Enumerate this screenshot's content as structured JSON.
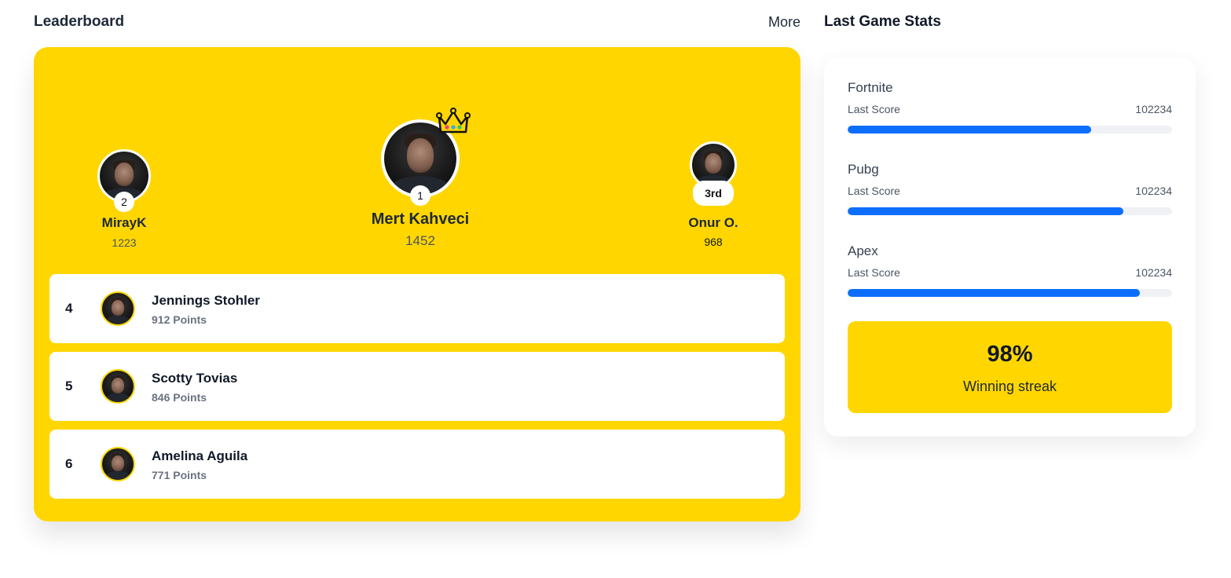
{
  "leaderboard": {
    "title": "Leaderboard",
    "more_label": "More",
    "podium": {
      "first": {
        "name": "Mert Kahveci",
        "score": "1452",
        "rank": "1",
        "icon": "crown-icon"
      },
      "second": {
        "name": "MirayK",
        "score": "1223",
        "rank": "2"
      },
      "third": {
        "name": "Onur O.",
        "score": "968",
        "rank": "3rd"
      }
    },
    "rows": [
      {
        "rank": "4",
        "name": "Jennings Stohler",
        "points": "912 Points"
      },
      {
        "rank": "5",
        "name": "Scotty Tovias",
        "points": "846 Points"
      },
      {
        "rank": "6",
        "name": "Amelina Aguila",
        "points": "771 Points"
      }
    ]
  },
  "stats": {
    "title": "Last Game Stats",
    "games": [
      {
        "name": "Fortnite",
        "label": "Last Score",
        "value": "102234",
        "progress": 0.75
      },
      {
        "name": "Pubg",
        "label": "Last Score",
        "value": "102234",
        "progress": 0.85
      },
      {
        "name": "Apex",
        "label": "Last Score",
        "value": "102234",
        "progress": 0.9
      }
    ],
    "streak": {
      "value": "98%",
      "label": "Winning streak"
    }
  },
  "colors": {
    "accent": "#FFD600",
    "progress": "#0d6efd",
    "track": "#eff1f5"
  }
}
